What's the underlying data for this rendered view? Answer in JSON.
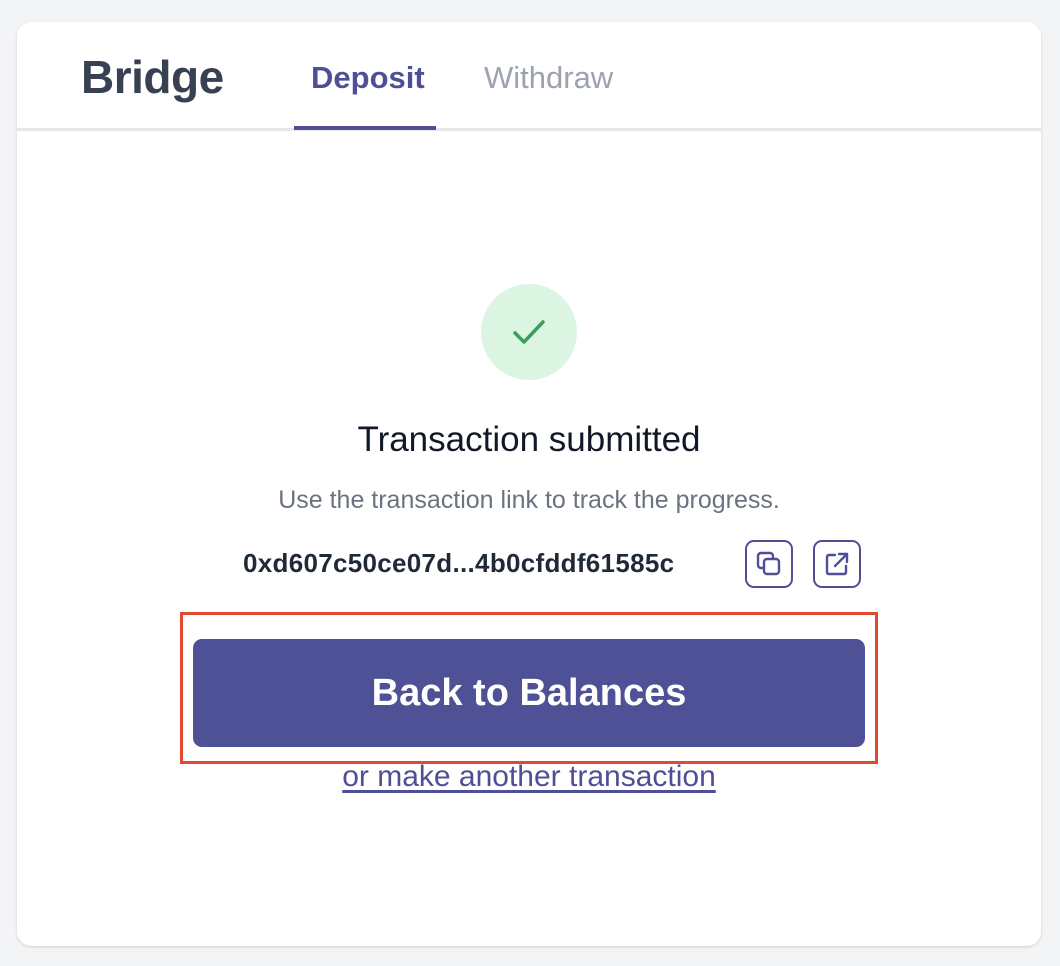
{
  "header": {
    "brand": "Bridge",
    "tabs": [
      {
        "label": "Deposit",
        "active": true
      },
      {
        "label": "Withdraw",
        "active": false
      }
    ]
  },
  "status": {
    "icon": "check-icon",
    "title": "Transaction submitted",
    "subtitle": "Use the transaction link to track the progress.",
    "tx_hash": "0xd607c50ce07d...4b0cfddf61585c"
  },
  "actions": {
    "copy_icon": "copy-icon",
    "external_link_icon": "external-link-icon",
    "primary_label": "Back to Balances",
    "secondary_link": "or make another transaction"
  },
  "colors": {
    "accent": "#4f4f96",
    "success_bg": "#dcf5e3",
    "success_icon": "#3f9d5a",
    "highlight": "#e04a2f"
  }
}
